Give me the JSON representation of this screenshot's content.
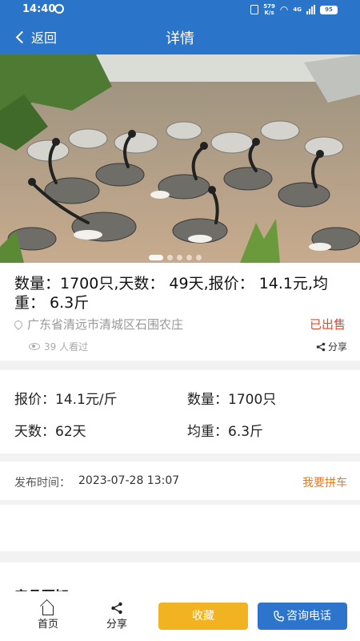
{
  "status": {
    "time": "14:40",
    "net_speed_top": "579",
    "net_speed_bottom": "K/s",
    "net_type": "4G",
    "battery": "95"
  },
  "nav": {
    "back_label": "返回",
    "title": "详情"
  },
  "gallery": {
    "slides": 5,
    "active_index": 0
  },
  "listing": {
    "title": "数量：1700只,天数：  49天,报价：  14.1元,均重：  6.3斤",
    "location": "广东省清远市清城区石围农庄",
    "status": "已出售",
    "views": "39 人看过",
    "share_label": "分享"
  },
  "specs": {
    "price_label": "报价：",
    "price_value": "14.1元/斤",
    "qty_label": "数量：",
    "qty_value": "1700只",
    "days_label": "天数：",
    "days_value": "62天",
    "avg_label": "均重：",
    "avg_value": "6.3斤"
  },
  "publish": {
    "label": "发布时间：",
    "value": "2023-07-28 13:07",
    "carpool_label": "我要拼车"
  },
  "next_section": {
    "title": "产品要知"
  },
  "bottom": {
    "home_label": "首页",
    "share_label": "分享",
    "favorite_label": "收藏",
    "call_label": "咨询电话"
  },
  "colors": {
    "header_blue": "#2a74c9",
    "sold_red": "#e1492b",
    "carpool_orange": "#e87a1e",
    "favorite_yellow": "#f1b321",
    "call_blue": "#2d74cc"
  },
  "icons": [
    "alarm-icon",
    "vibrate-icon",
    "wifi-icon",
    "signal-icon",
    "battery-icon",
    "back-chevron-icon",
    "location-pin-icon",
    "eye-icon",
    "share-icon",
    "home-icon",
    "phone-icon"
  ]
}
